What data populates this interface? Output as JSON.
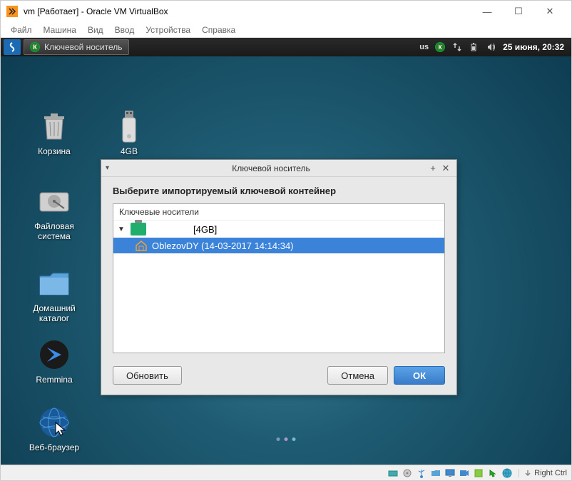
{
  "vbox": {
    "title": "vm [Работает] - Oracle VM VirtualBox",
    "menu": {
      "file": "Файл",
      "machine": "Машина",
      "view": "Вид",
      "input": "Ввод",
      "devices": "Устройства",
      "help": "Справка"
    },
    "hostkey": "Right Ctrl"
  },
  "guest_panel": {
    "task_label": "Ключевой носитель",
    "kb_layout": "us",
    "clock": "25 июня, 20:32"
  },
  "desktop": {
    "trash": "Корзина",
    "usb": "4GB",
    "filesystem": "Файловая\nсистема",
    "home": "Домашний\nкаталог",
    "remmina": "Remmina",
    "browser": "Веб-браузер"
  },
  "dialog": {
    "title": "Ключевой носитель",
    "heading": "Выберите импортируемый ключевой контейнер",
    "tree_header": "Ключевые носители",
    "device_label": "[4GB]",
    "container_label": "OblezovDY (14-03-2017 14:14:34)",
    "btn_refresh": "Обновить",
    "btn_cancel": "Отмена",
    "btn_ok": "ОК"
  }
}
